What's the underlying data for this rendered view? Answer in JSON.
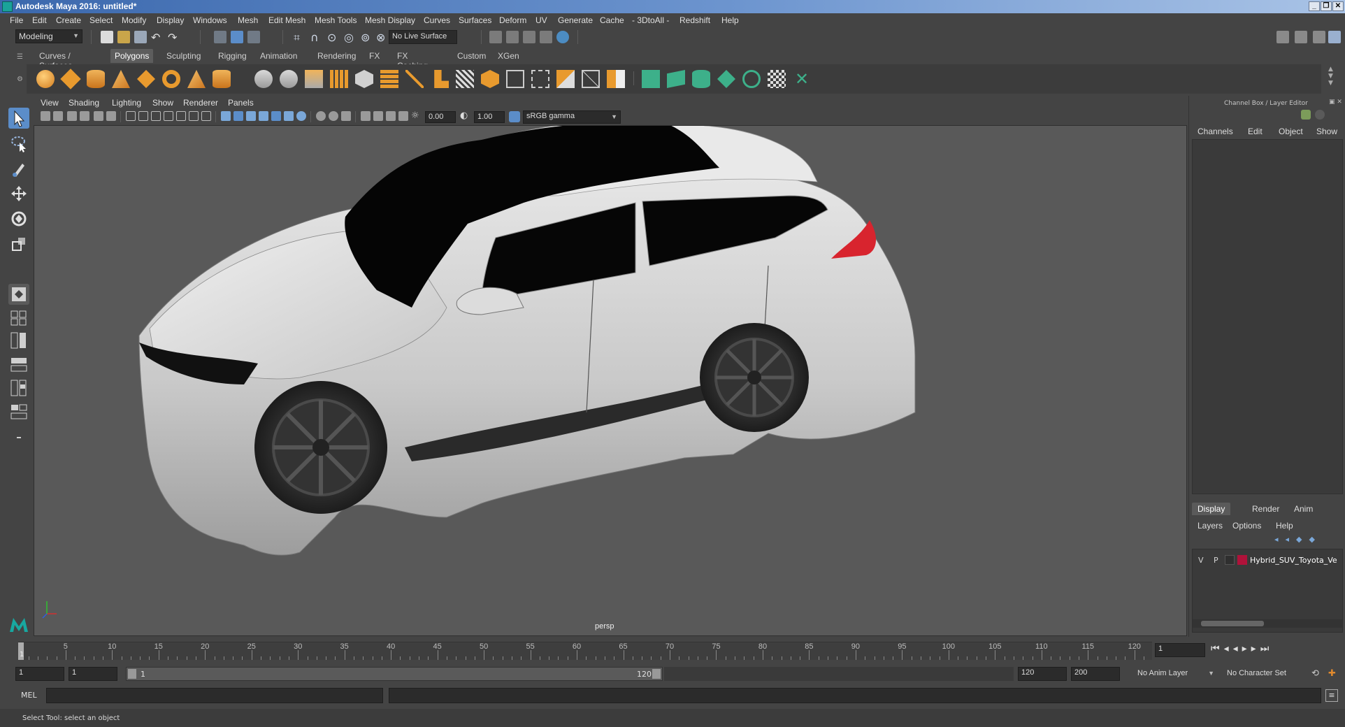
{
  "window": {
    "title": "Autodesk Maya 2016: untitled*",
    "controls": [
      "minimize",
      "restore",
      "close"
    ]
  },
  "menubar": [
    "File",
    "Edit",
    "Create",
    "Select",
    "Modify",
    "Display",
    "Windows",
    "Mesh",
    "Edit Mesh",
    "Mesh Tools",
    "Mesh Display",
    "Curves",
    "Surfaces",
    "Deform",
    "UV",
    "Generate",
    "Cache",
    "- 3DtoAll -",
    "Redshift",
    "Help"
  ],
  "statusline": {
    "mode": "Modeling",
    "live_surface": "No Live Surface"
  },
  "shelf_tabs": [
    "Curves / Surfaces",
    "Polygons",
    "Sculpting",
    "Rigging",
    "Animation",
    "Rendering",
    "FX",
    "FX Caching",
    "Custom",
    "XGen"
  ],
  "shelf_active": "Polygons",
  "panel_menu": [
    "View",
    "Shading",
    "Lighting",
    "Show",
    "Renderer",
    "Panels"
  ],
  "view_toolbar": {
    "exposure": "0.00",
    "gamma": "1.00",
    "color_space": "sRGB gamma"
  },
  "viewport": {
    "camera_label": "persp"
  },
  "channel_box": {
    "title": "Channel Box / Layer Editor",
    "tabs": [
      "Channels",
      "Edit",
      "Object",
      "Show"
    ]
  },
  "layer_editor": {
    "tabs": [
      "Display",
      "Render",
      "Anim"
    ],
    "active_tab": "Display",
    "menu": [
      "Layers",
      "Options",
      "Help"
    ],
    "layers": [
      {
        "v": "V",
        "p": "P",
        "color": "#b0123a",
        "name": "Hybrid_SUV_Toyota_Ve"
      }
    ]
  },
  "timeline": {
    "ticks": [
      5,
      10,
      15,
      20,
      25,
      30,
      35,
      40,
      45,
      50,
      55,
      60,
      65,
      70,
      75,
      80,
      85,
      90,
      95,
      100,
      105,
      110,
      115,
      120
    ],
    "current_frame_marker": "1",
    "current_frame_field": "1"
  },
  "range": {
    "start": "1",
    "playback_start": "1",
    "range_start_label": "1",
    "range_end_label": "120",
    "playback_end": "120",
    "end": "200",
    "anim_layer": "No Anim Layer",
    "character_set": "No Character Set"
  },
  "command_line": {
    "language": "MEL"
  },
  "help_line": "Select Tool: select an object",
  "colors": {
    "accent": "#5b8dc9",
    "shelf_orange": "#e89a2e",
    "shelf_green": "#3db08a",
    "taillight": "#d8242e"
  }
}
